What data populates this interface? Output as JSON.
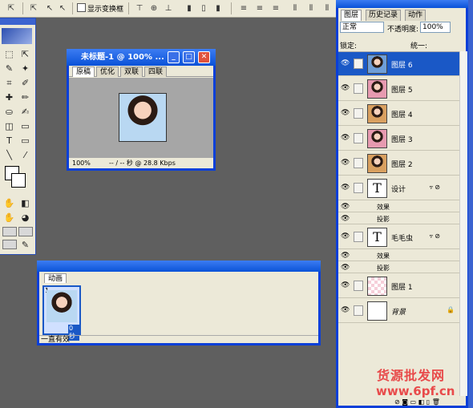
{
  "options_bar": {
    "show_transform_controls_label": "显示变换框"
  },
  "doc_window": {
    "title": "未标题-1 @ 100% ...",
    "tabs": [
      "原稿",
      "优化",
      "双联",
      "四联"
    ],
    "zoom": "100%",
    "info": "-- / -- 秒 @ 28.8 Kbps"
  },
  "animation_panel": {
    "tab_label": "动画",
    "frame_number": "1",
    "frame_time": "0秒",
    "loop_label": "一直有效"
  },
  "layers_panel": {
    "tabs": [
      "图层",
      "历史记录",
      "动作"
    ],
    "blend_mode": "正常",
    "opacity_label": "不透明度:",
    "opacity_value": "100%",
    "lock_label": "锁定:",
    "unify_label": "统一:",
    "layers": [
      {
        "name": "图层 6",
        "selected": true
      },
      {
        "name": "图层 5"
      },
      {
        "name": "图层 4"
      },
      {
        "name": "图层 3"
      },
      {
        "name": "图层 2"
      },
      {
        "name": "设计",
        "text": true,
        "effects_label": "效果",
        "effect": "投影"
      },
      {
        "name": "毛毛虫",
        "text": true,
        "effects_label": "效果",
        "effect": "投影"
      },
      {
        "name": "图层 1"
      },
      {
        "name": "背景",
        "locked": true
      }
    ]
  },
  "watermark": {
    "line1": "货源批发网",
    "line2": "www.6pf.cn"
  }
}
